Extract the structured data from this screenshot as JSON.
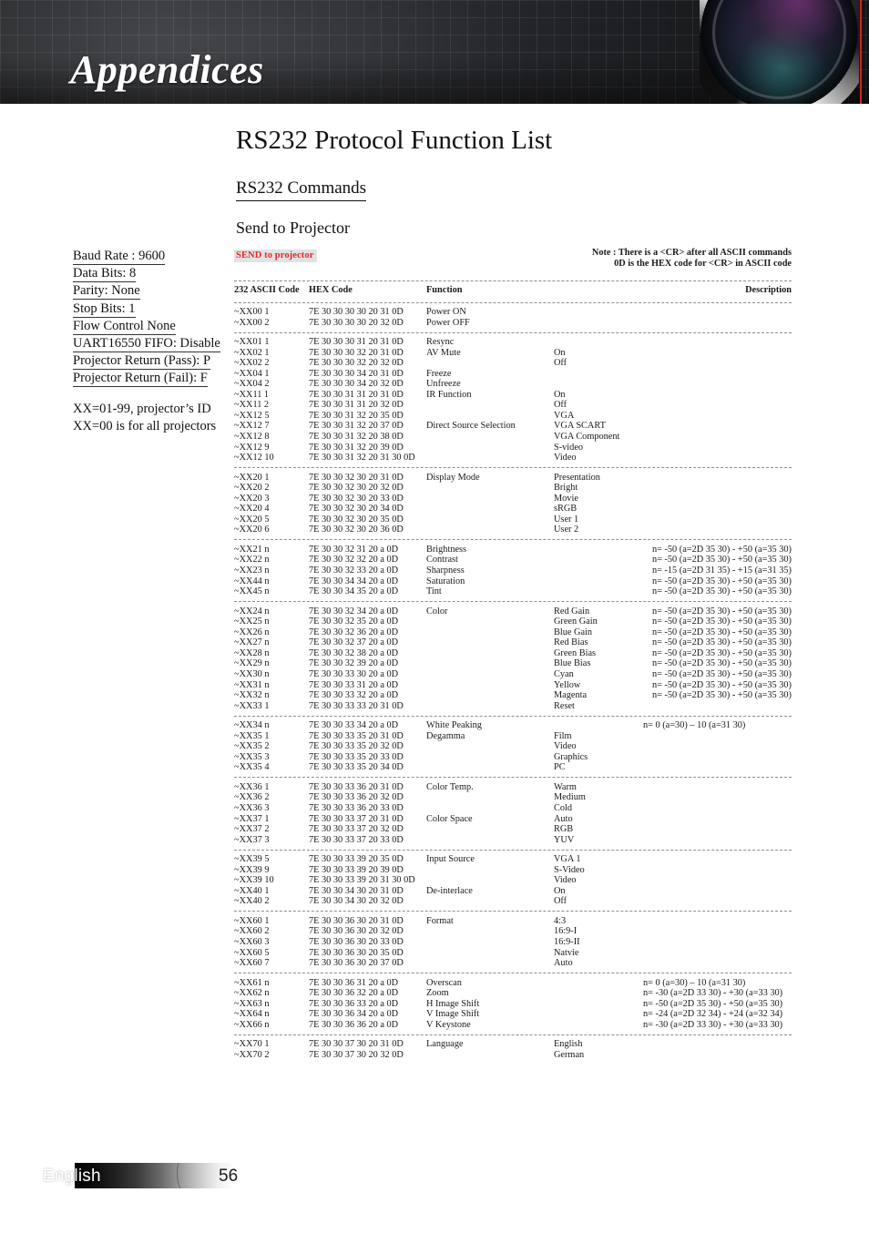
{
  "header": {
    "title": "Appendices",
    "accent_color": "#d42027"
  },
  "page": {
    "title": "RS232 Protocol Function List",
    "section_title": "RS232 Commands",
    "sub_title": "Send to Projector"
  },
  "sidebar": {
    "lines": [
      "Baud Rate : 9600",
      "Data Bits: 8",
      "Parity: None",
      "Stop Bits: 1",
      "Flow Control None",
      "UART16550 FIFO: Disable",
      "Projector Return (Pass): P",
      "Projector Return (Fail): F"
    ],
    "notes": [
      "XX=01-99, projector’s ID",
      "XX=00 is for all projectors"
    ]
  },
  "table": {
    "send_badge": "SEND to projector",
    "send_badge_color": "#e8262c",
    "note_line_1": "Note : There is a <CR> after all ASCII commands",
    "note_line_2": "0D is the HEX code for <CR> in ASCII code",
    "headers": {
      "ascii": "232 ASCII Code",
      "hex": "HEX Code",
      "function": "Function",
      "description": "Description"
    },
    "groups": [
      {
        "rows": [
          {
            "ascii": "~XX00 1",
            "hex": "7E 30 30 30 30 20 31 0D",
            "function": "Power ON",
            "value": "",
            "description": ""
          },
          {
            "ascii": "~XX00 2",
            "hex": "7E 30 30 30 30 20 32 0D",
            "function": "Power OFF",
            "value": "",
            "description": ""
          }
        ]
      },
      {
        "rows": [
          {
            "ascii": "~XX01 1",
            "hex": "7E 30 30 30 31 20 31 0D",
            "function": "Resync",
            "value": "",
            "description": ""
          },
          {
            "ascii": "~XX02 1",
            "hex": "7E 30 30 30 32 20 31 0D",
            "function": "AV Mute",
            "value": "On",
            "description": ""
          },
          {
            "ascii": "~XX02 2",
            "hex": "7E 30 30 30 32 20 32 0D",
            "function": "",
            "value": "Off",
            "description": ""
          },
          {
            "ascii": "~XX04 1",
            "hex": "7E 30 30 30 34 20 31 0D",
            "function": "Freeze",
            "value": "",
            "description": ""
          },
          {
            "ascii": "~XX04 2",
            "hex": "7E 30 30 30 34 20 32 0D",
            "function": "Unfreeze",
            "value": "",
            "description": ""
          },
          {
            "ascii": "~XX11 1",
            "hex": "7E 30 30 31 31 20 31 0D",
            "function": "IR Function",
            "value": "On",
            "description": ""
          },
          {
            "ascii": "~XX11 2",
            "hex": "7E 30 30 31 31 20 32 0D",
            "function": "",
            "value": "Off",
            "description": ""
          },
          {
            "ascii": "~XX12 5",
            "hex": "7E 30 30 31 32 20 35 0D",
            "function": "",
            "value": "VGA",
            "description": ""
          },
          {
            "ascii": "~XX12 7",
            "hex": "7E 30 30 31 32 20 37 0D",
            "function": "Direct Source Selection",
            "value": "VGA SCART",
            "description": ""
          },
          {
            "ascii": "~XX12 8",
            "hex": "7E 30 30 31 32 20 38 0D",
            "function": "",
            "value": "VGA Component",
            "description": ""
          },
          {
            "ascii": "~XX12 9",
            "hex": "7E 30 30 31 32 20 39 0D",
            "function": "",
            "value": "S-video",
            "description": ""
          },
          {
            "ascii": "~XX12 10",
            "hex": "7E 30 30 31 32 20 31 30 0D",
            "function": "",
            "value": "Video",
            "description": ""
          }
        ]
      },
      {
        "rows": [
          {
            "ascii": "~XX20 1",
            "hex": "7E 30 30 32 30 20 31 0D",
            "function": "Display Mode",
            "value": "Presentation",
            "description": ""
          },
          {
            "ascii": "~XX20 2",
            "hex": "7E 30 30 32 30 20 32 0D",
            "function": "",
            "value": "Bright",
            "description": ""
          },
          {
            "ascii": "~XX20 3",
            "hex": "7E 30 30 32 30 20 33 0D",
            "function": "",
            "value": "Movie",
            "description": ""
          },
          {
            "ascii": "~XX20 4",
            "hex": "7E 30 30 32 30 20 34 0D",
            "function": "",
            "value": "sRGB",
            "description": ""
          },
          {
            "ascii": "~XX20 5",
            "hex": "7E 30 30 32 30 20 35 0D",
            "function": "",
            "value": "User 1",
            "description": ""
          },
          {
            "ascii": "~XX20 6",
            "hex": "7E 30 30 32 30 20 36 0D",
            "function": "",
            "value": "User 2",
            "description": ""
          }
        ]
      },
      {
        "rows": [
          {
            "ascii": "~XX21 n",
            "hex": "7E 30 30 32 31 20  a 0D",
            "function": "Brightness",
            "value": "",
            "description": "n= -50 (a=2D 35 30) - +50 (a=35 30)"
          },
          {
            "ascii": "~XX22 n",
            "hex": "7E 30 30 32 32 20  a 0D",
            "function": "Contrast",
            "value": "",
            "description": "n= -50 (a=2D 35 30) - +50 (a=35 30)"
          },
          {
            "ascii": "~XX23 n",
            "hex": "7E 30 30 32 33 20  a 0D",
            "function": "Sharpness",
            "value": "",
            "description": "n= -15 (a=2D 31 35) - +15 (a=31 35)"
          },
          {
            "ascii": "~XX44 n",
            "hex": "7E 30 30 34 34 20  a 0D",
            "function": "Saturation",
            "value": "",
            "description": "n= -50 (a=2D 35 30) - +50 (a=35 30)"
          },
          {
            "ascii": "~XX45 n",
            "hex": "7E 30 30 34 35 20  a 0D",
            "function": "Tint",
            "value": "",
            "description": "n= -50 (a=2D 35 30) - +50 (a=35 30)"
          }
        ]
      },
      {
        "rows": [
          {
            "ascii": "~XX24 n",
            "hex": "7E 30 30 32 34 20  a 0D",
            "function": "Color",
            "value": "Red Gain",
            "description": "n= -50 (a=2D 35 30) - +50 (a=35 30)"
          },
          {
            "ascii": "~XX25 n",
            "hex": "7E 30 30 32 35 20  a 0D",
            "function": "",
            "value": "Green Gain",
            "description": "n= -50 (a=2D 35 30) - +50 (a=35 30)"
          },
          {
            "ascii": "~XX26 n",
            "hex": "7E 30 30 32 36 20  a 0D",
            "function": "",
            "value": "Blue Gain",
            "description": "n= -50 (a=2D 35 30) - +50 (a=35 30)"
          },
          {
            "ascii": "~XX27 n",
            "hex": "7E 30 30 32 37 20  a 0D",
            "function": "",
            "value": "Red Bias",
            "description": "n= -50 (a=2D 35 30) - +50 (a=35 30)"
          },
          {
            "ascii": "~XX28 n",
            "hex": "7E 30 30 32 38 20  a 0D",
            "function": "",
            "value": "Green Bias",
            "description": "n= -50 (a=2D 35 30) - +50 (a=35 30)"
          },
          {
            "ascii": "~XX29 n",
            "hex": "7E 30 30 32 39 20  a 0D",
            "function": "",
            "value": "Blue Bias",
            "description": "n= -50 (a=2D 35 30) - +50 (a=35 30)"
          },
          {
            "ascii": "~XX30 n",
            "hex": "7E 30 30 33 30 20  a 0D",
            "function": "",
            "value": "Cyan",
            "description": "n= -50 (a=2D 35 30) - +50 (a=35 30)"
          },
          {
            "ascii": "~XX31 n",
            "hex": "7E 30 30 33 31 20  a 0D",
            "function": "",
            "value": "Yellow",
            "description": "n= -50 (a=2D 35 30) - +50 (a=35 30)"
          },
          {
            "ascii": "~XX32 n",
            "hex": "7E 30 30 33 32 20  a 0D",
            "function": "",
            "value": "Magenta",
            "description": "n= -50 (a=2D 35 30) - +50 (a=35 30)"
          },
          {
            "ascii": "~XX33 1",
            "hex": "7E 30 30 33 33 20  31 0D",
            "function": "",
            "value": "Reset",
            "description": ""
          }
        ]
      },
      {
        "rows": [
          {
            "ascii": "~XX34 n",
            "hex": "7E 30 30 33 34 20 a 0D",
            "function": "White Peaking",
            "value": "",
            "description_mid": "n= 0 (a=30) – 10 (a=31 30)"
          },
          {
            "ascii": "~XX35 1",
            "hex": "7E 30 30 33 35 20 31 0D",
            "function": "Degamma",
            "value": "Film",
            "description": ""
          },
          {
            "ascii": "~XX35 2",
            "hex": "7E 30 30 33 35 20 32 0D",
            "function": "",
            "value": "Video",
            "description": ""
          },
          {
            "ascii": "~XX35 3",
            "hex": "7E 30 30 33 35 20 33 0D",
            "function": "",
            "value": "Graphics",
            "description": ""
          },
          {
            "ascii": "~XX35 4",
            "hex": "7E 30 30 33 35 20 34 0D",
            "function": "",
            "value": "PC",
            "description": ""
          }
        ]
      },
      {
        "rows": [
          {
            "ascii": "~XX36 1",
            "hex": "7E 30 30 33 36 20 31 0D",
            "function": "Color Temp.",
            "value": "Warm",
            "description": ""
          },
          {
            "ascii": "~XX36 2",
            "hex": "7E 30 30 33 36 20 32 0D",
            "function": "",
            "value": "Medium",
            "description": ""
          },
          {
            "ascii": "~XX36 3",
            "hex": "7E 30 30 33 36 20 33 0D",
            "function": "",
            "value": "Cold",
            "description": ""
          },
          {
            "ascii": "~XX37 1",
            "hex": "7E 30 30 33 37 20 31 0D",
            "function": "Color Space",
            "value": "Auto",
            "description": ""
          },
          {
            "ascii": "~XX37 2",
            "hex": "7E 30 30 33 37 20 32 0D",
            "function": "",
            "value": "RGB",
            "description": ""
          },
          {
            "ascii": "~XX37 3",
            "hex": "7E 30 30 33 37 20 33 0D",
            "function": "",
            "value": "YUV",
            "description": ""
          }
        ]
      },
      {
        "rows": [
          {
            "ascii": "~XX39 5",
            "hex": "7E 30 30 33 39 20 35 0D",
            "function": "Input Source",
            "value": "VGA 1",
            "description": ""
          },
          {
            "ascii": "~XX39 9",
            "hex": "7E 30 30 33 39 20 39 0D",
            "function": "",
            "value": "S-Video",
            "description": ""
          },
          {
            "ascii": "~XX39 10",
            "hex": "7E 30 30 33 39 20 31 30 0D",
            "function": "",
            "value": "Video",
            "description": ""
          },
          {
            "ascii": "~XX40 1",
            "hex": "7E 30 30 34 30 20 31 0D",
            "function": "De-interlace",
            "value": "On",
            "description": ""
          },
          {
            "ascii": "~XX40 2",
            "hex": "7E 30 30 34 30 20 32 0D",
            "function": "",
            "value": "Off",
            "description": ""
          }
        ]
      },
      {
        "rows": [
          {
            "ascii": "~XX60 1",
            "hex": "7E 30 30 36 30 20 31 0D",
            "function": "Format",
            "value": "4:3",
            "description": ""
          },
          {
            "ascii": "~XX60 2",
            "hex": "7E 30 30 36 30 20 32 0D",
            "function": "",
            "value": "16:9-I",
            "description": ""
          },
          {
            "ascii": "~XX60 3",
            "hex": "7E 30 30 36 30 20 33 0D",
            "function": "",
            "value": "16:9-II",
            "description": ""
          },
          {
            "ascii": "~XX60 5",
            "hex": "7E 30 30 36 30 20 35 0D",
            "function": "",
            "value": "Natvie",
            "description": ""
          },
          {
            "ascii": "~XX60 7",
            "hex": "7E 30 30 36 30 20 37 0D",
            "function": "",
            "value": "Auto",
            "description": ""
          }
        ]
      },
      {
        "rows": [
          {
            "ascii": "~XX61 n",
            "hex": "7E 30 30 36 31 20 a 0D",
            "function": "Overscan",
            "value": "",
            "description_mid": "n= 0 (a=30) – 10 (a=31 30)"
          },
          {
            "ascii": "~XX62 n",
            "hex": "7E 30 30 36 32 20 a 0D",
            "function": "Zoom",
            "value": "",
            "description_mid": "n= -30 (a=2D 33 30) - +30 (a=33 30)"
          },
          {
            "ascii": "~XX63 n",
            "hex": "7E 30 30 36 33 20 a 0D",
            "function": "H Image Shift",
            "value": "",
            "description_mid": "n= -50 (a=2D 35 30) - +50 (a=35 30)"
          },
          {
            "ascii": "~XX64 n",
            "hex": "7E 30 30 36 34 20 a 0D",
            "function": "V Image Shift",
            "value": "",
            "description_mid": "n= -24 (a=2D 32 34) - +24 (a=32 34)"
          },
          {
            "ascii": "~XX66 n",
            "hex": "7E 30 30 36 36 20 a 0D",
            "function": "V Keystone",
            "value": "",
            "description_mid": "n= -30 (a=2D 33 30) - +30 (a=33 30)"
          }
        ]
      },
      {
        "rows": [
          {
            "ascii": "~XX70 1",
            "hex": "7E 30 30 37 30 20 31 0D",
            "function": "Language",
            "value": "English",
            "description": ""
          },
          {
            "ascii": "~XX70 2",
            "hex": "7E 30 30 37 30 20 32 0D",
            "function": "",
            "value": "German",
            "description": ""
          }
        ]
      }
    ]
  },
  "footer": {
    "language": "English",
    "page_number": "56"
  }
}
